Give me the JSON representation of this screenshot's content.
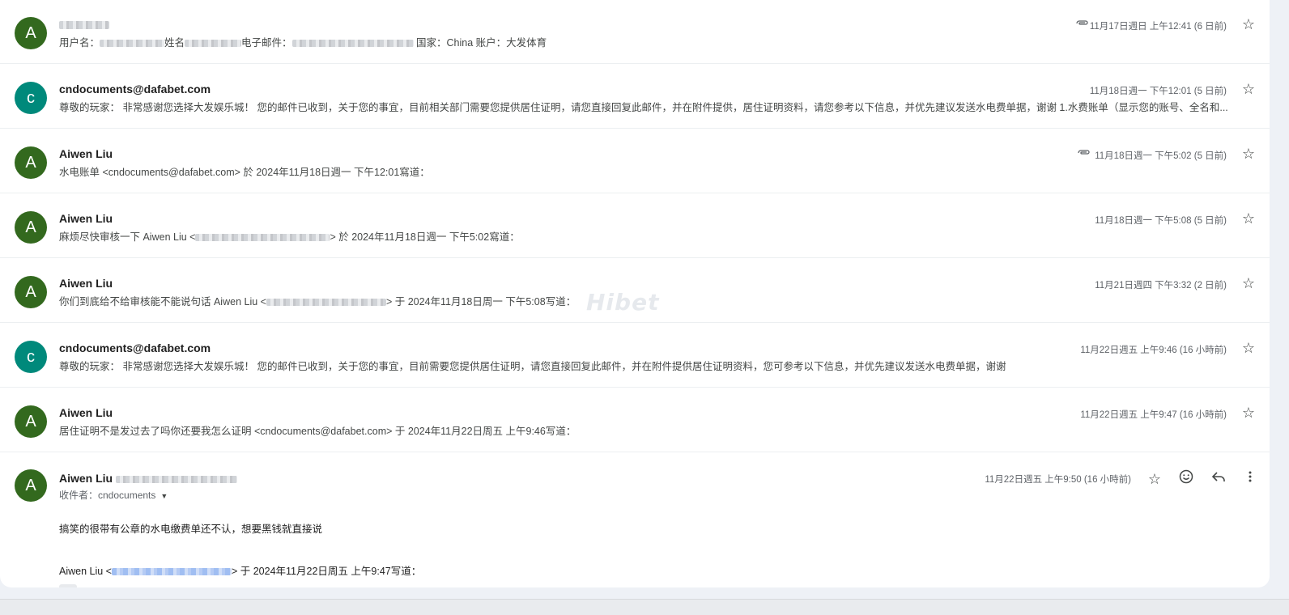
{
  "colors": {
    "avatar_green": "#33691e",
    "avatar_teal": "#00897b"
  },
  "messages": [
    {
      "avatar_letter": "A",
      "sender_prefix": "",
      "snippet_parts": [
        "用户名：",
        "姓名",
        "电子邮件：",
        "国家：China 账户：大发体育"
      ],
      "date": "11月17日週日 上午12:41 (6 日前)",
      "has_attachment": true
    },
    {
      "avatar_letter": "c",
      "sender": "cndocuments@dafabet.com",
      "snippet": "尊敬的玩家： 非常感谢您选择大发娱乐城！ 您的邮件已收到，关于您的事宜，目前相关部门需要您提供居住证明，请您直接回复此邮件，并在附件提供，居住证明资料，请您参考以下信息，并优先建议发送水电费单据，谢谢 1.水费账单（显示您的账号、全名和...",
      "date": "11月18日週一 下午12:01 (5 日前)",
      "has_attachment": false
    },
    {
      "avatar_letter": "A",
      "sender": "Aiwen Liu",
      "snippet": "水电账单 <cndocuments@dafabet.com> 於 2024年11月18日週一 下午12:01寫道：",
      "date": "11月18日週一 下午5:02 (5 日前)",
      "has_attachment": true
    },
    {
      "avatar_letter": "A",
      "sender": "Aiwen Liu",
      "snippet_before": "麻烦尽快审核一下 Aiwen Liu <",
      "snippet_after": "> 於 2024年11月18日週一 下午5:02寫道：",
      "date": "11月18日週一 下午5:08 (5 日前)",
      "has_attachment": false
    },
    {
      "avatar_letter": "A",
      "sender": "Aiwen Liu",
      "snippet_before": "你们到底给不给审核能不能说句话 Aiwen Liu <",
      "snippet_after": "> 于 2024年11月18日周一 下午5:08写道：",
      "date": "11月21日週四 下午3:32 (2 日前)",
      "has_attachment": false
    },
    {
      "avatar_letter": "c",
      "sender": "cndocuments@dafabet.com",
      "snippet": "尊敬的玩家： 非常感谢您选择大发娱乐城！ 您的邮件已收到，关于您的事宜，目前需要您提供居住证明，请您直接回复此邮件，并在附件提供居住证明资料，您可参考以下信息，并优先建议发送水电费单据，谢谢",
      "date": "11月22日週五 上午9:46 (16 小時前)",
      "has_attachment": false
    },
    {
      "avatar_letter": "A",
      "sender": "Aiwen Liu",
      "snippet": "居住证明不是发过去了吗你还要我怎么证明 <cndocuments@dafabet.com> 于 2024年11月22日周五 上午9:46写道：",
      "date": "11月22日週五 上午9:47 (16 小時前)",
      "has_attachment": false
    }
  ],
  "expanded": {
    "avatar_letter": "A",
    "sender": "Aiwen Liu",
    "recipient_label": "收件者：cndocuments",
    "date": "11月22日週五 上午9:50 (16 小時前)",
    "body": "搞笑的很带有公章的水电缴费单还不认，想要黑钱就直接说",
    "quote_before": "Aiwen Liu <",
    "quote_after": "> 于 2024年11月22日周五 上午9:47写道："
  },
  "watermark": "Hibet"
}
